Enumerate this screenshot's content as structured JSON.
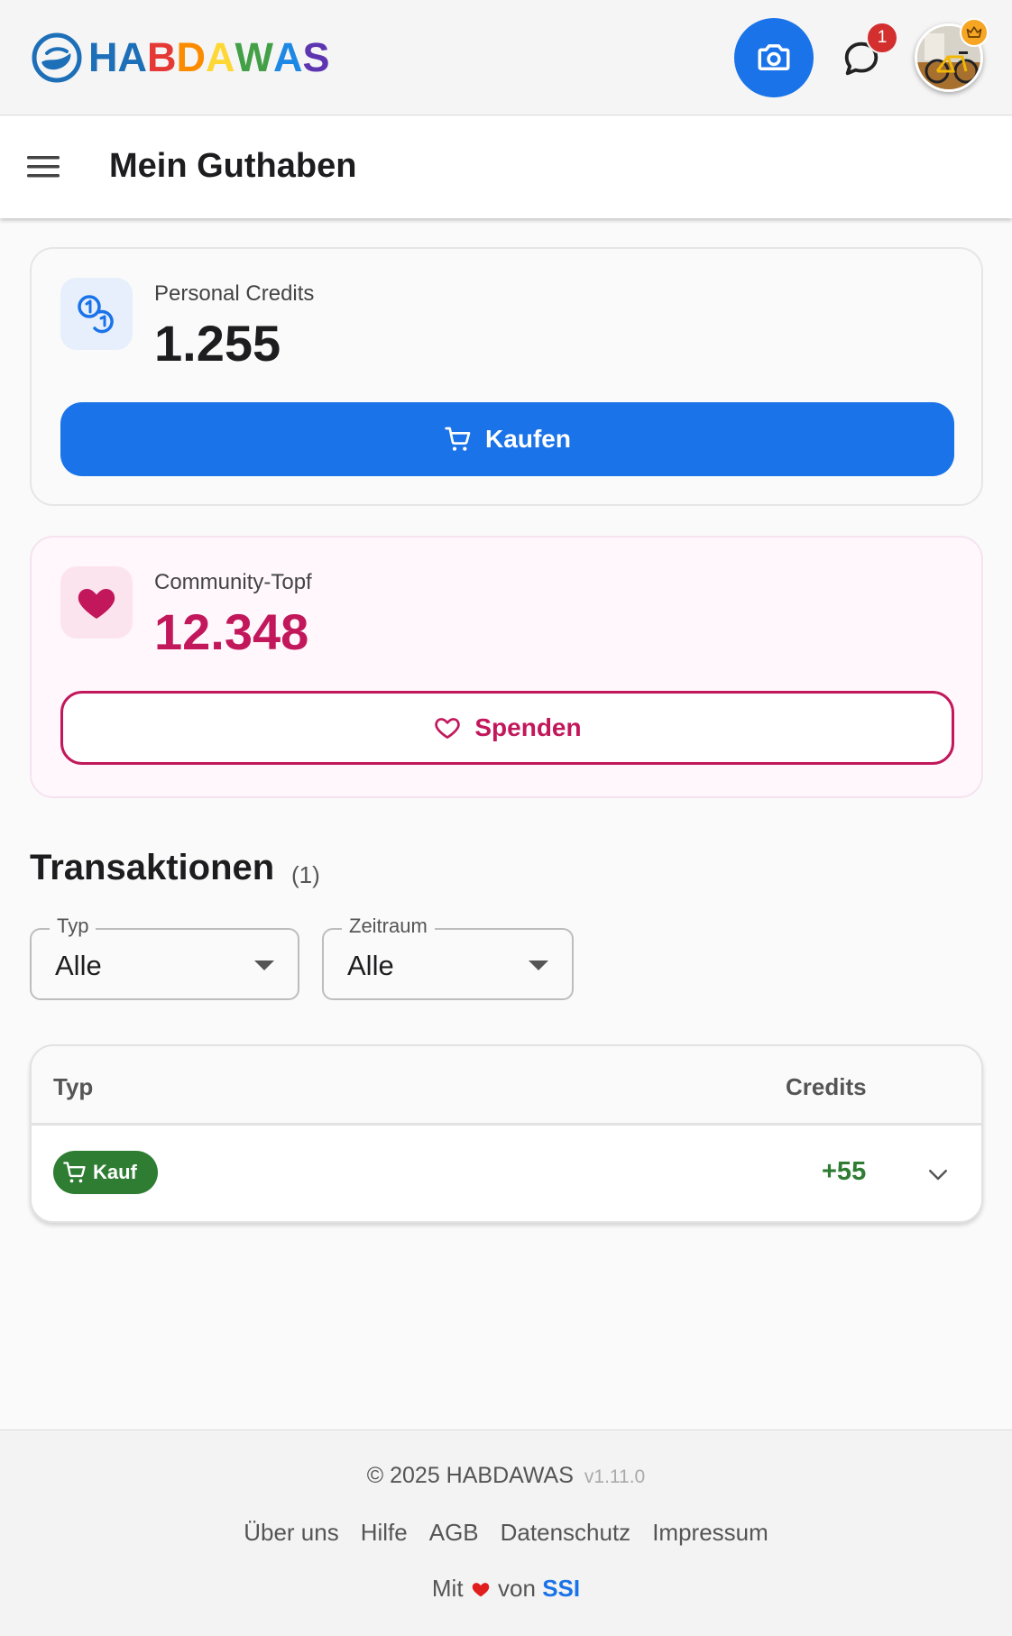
{
  "header": {
    "logo_text": "HABDAWAS",
    "logo_letters": [
      {
        "ch": "H",
        "color": "#1d6fb8"
      },
      {
        "ch": "A",
        "color": "#1d6fb8"
      },
      {
        "ch": "B",
        "color": "#e53935"
      },
      {
        "ch": "D",
        "color": "#fb8c00"
      },
      {
        "ch": "A",
        "color": "#fdd835"
      },
      {
        "ch": "W",
        "color": "#43a047"
      },
      {
        "ch": "A",
        "color": "#1e88e5"
      },
      {
        "ch": "S",
        "color": "#5e35b1"
      }
    ],
    "chat_badge_count": "1",
    "icons": [
      "camera-icon",
      "chat-icon",
      "crown-icon"
    ]
  },
  "page": {
    "title": "Mein Guthaben"
  },
  "credits": {
    "label": "Personal Credits",
    "value": "1.255",
    "button_label": "Kaufen"
  },
  "topf": {
    "label": "Community-Topf",
    "value": "12.348",
    "button_label": "Spenden"
  },
  "transactions": {
    "title": "Transaktionen",
    "count": "(1)",
    "filters": {
      "typ": {
        "label": "Typ",
        "value": "Alle"
      },
      "zeitraum": {
        "label": "Zeitraum",
        "value": "Alle"
      }
    },
    "columns": {
      "typ": "Typ",
      "credits": "Credits"
    },
    "rows": [
      {
        "type": "Kauf",
        "credits": "+55"
      }
    ]
  },
  "footer": {
    "copyright": "© 2025 HABDAWAS",
    "version": "v1.11.0",
    "links": [
      "Über uns",
      "Hilfe",
      "AGB",
      "Datenschutz",
      "Impressum"
    ],
    "made_prefix": "Mit",
    "made_middle": "von",
    "made_brand": "SSI"
  },
  "colors": {
    "primary": "#1a73e8",
    "community": "#c2185b",
    "positive": "#2e7d32"
  }
}
